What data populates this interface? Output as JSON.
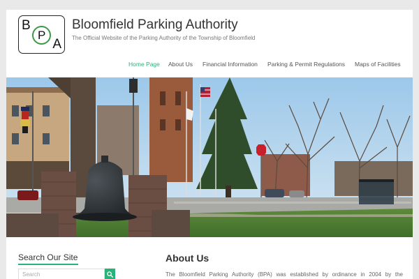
{
  "site": {
    "logo_letters": {
      "b": "B",
      "p": "P",
      "a": "A"
    },
    "title": "Bloomfield Parking Authority",
    "tagline": "The Official Website of the Parking Authority of the Township of Bloomfield"
  },
  "nav": {
    "items": [
      {
        "label": "Home Page",
        "active": true
      },
      {
        "label": "About Us"
      },
      {
        "label": "Financial Information"
      },
      {
        "label": "Parking & Permit Regulations"
      },
      {
        "label": "Maps of Facilities"
      }
    ]
  },
  "hero": {
    "scene": "town green with bell monument, trees, flagpoles and church tower",
    "signs": [
      "STOP"
    ]
  },
  "sidebar": {
    "search_heading": "Search Our Site",
    "search_placeholder": "Search",
    "search_icon": "search-icon"
  },
  "main": {
    "heading": "About Us",
    "intro": "The Bloomfield Parking Authority (BPA) was established by ordinance in 2004 by the"
  },
  "colors": {
    "accent": "#2ab27b",
    "logo_ring": "#3a9a44",
    "background": "#e9e9e9"
  }
}
